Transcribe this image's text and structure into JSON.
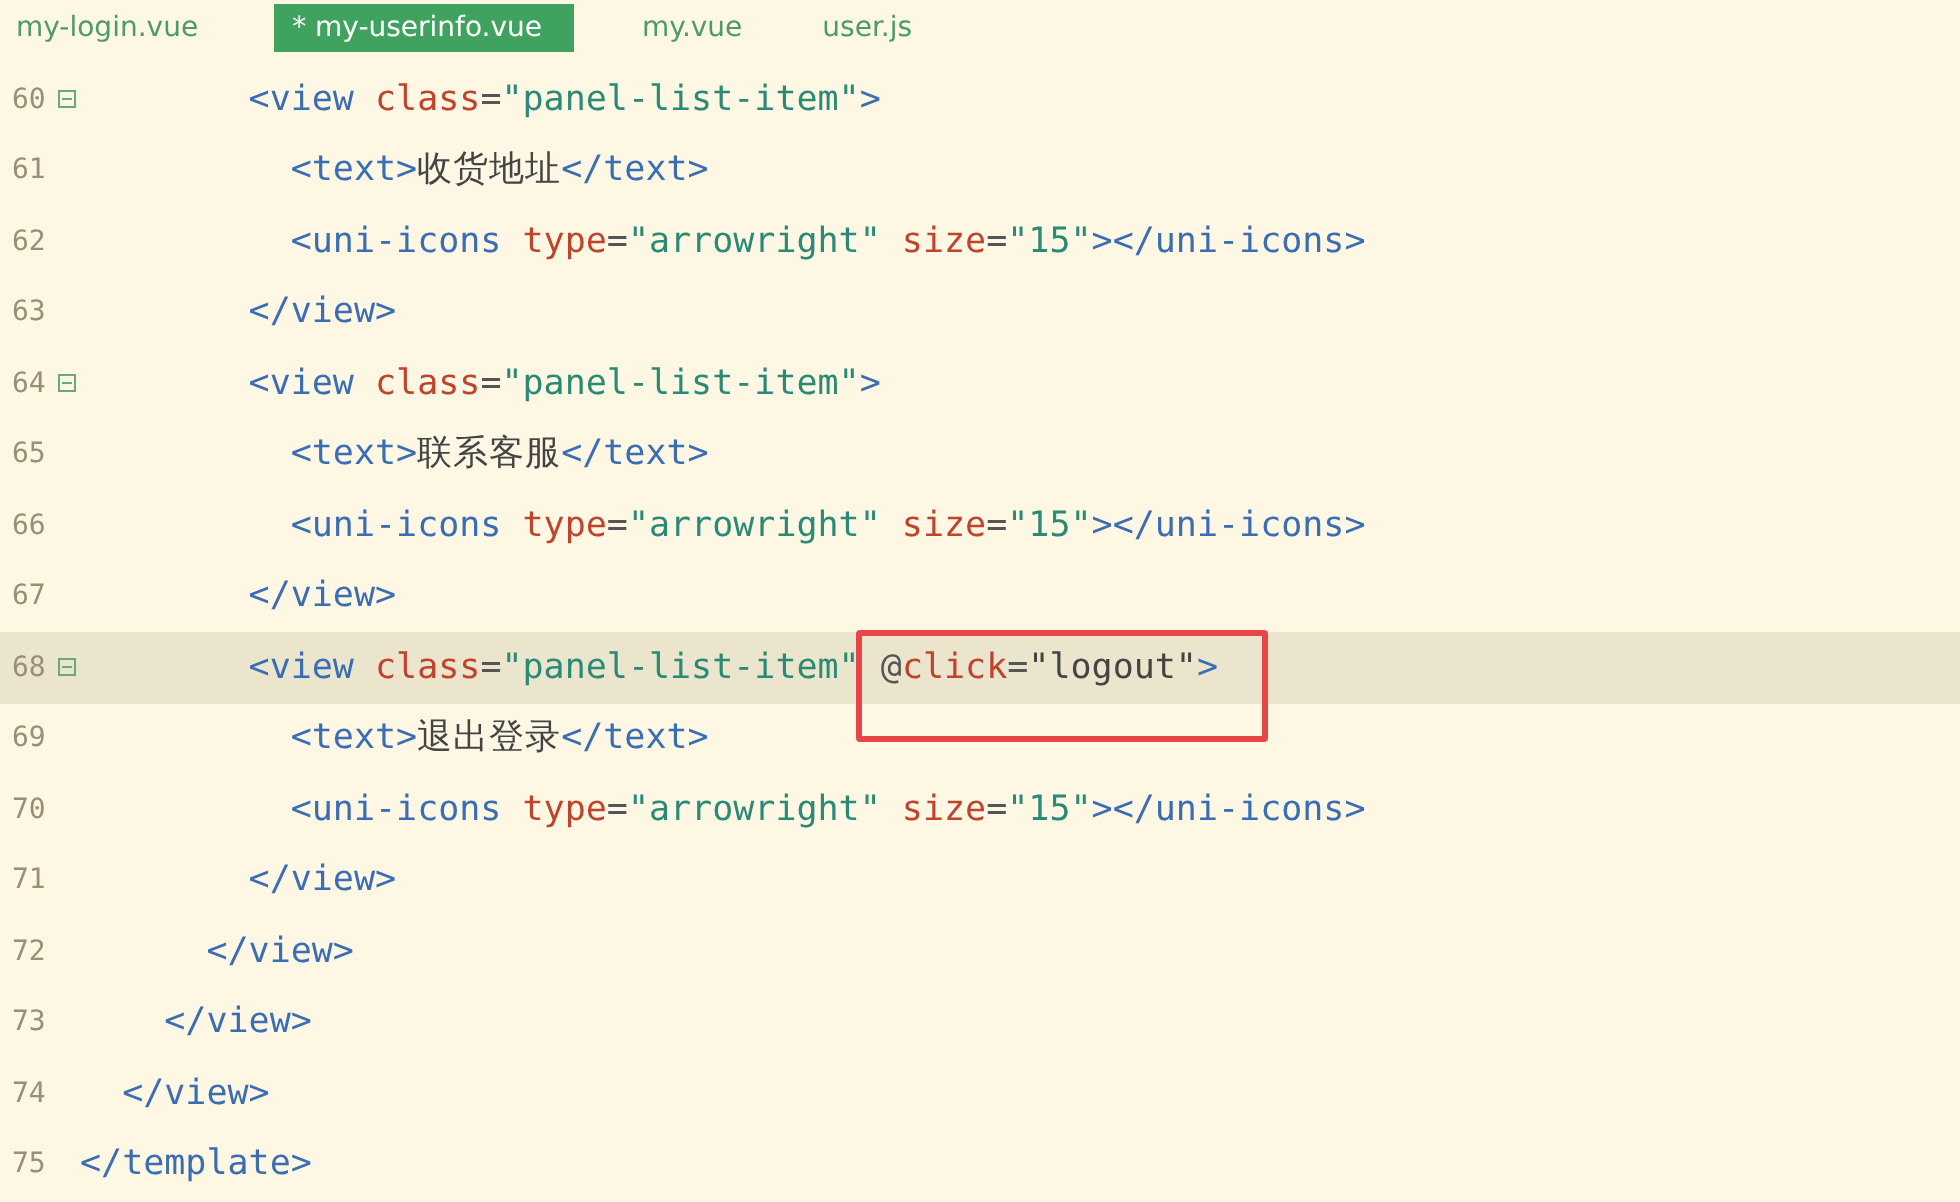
{
  "tabs": [
    {
      "label": "my-login.vue",
      "selected": false
    },
    {
      "label": "* my-userinfo.vue",
      "selected": true
    },
    {
      "label": "my.vue",
      "selected": false
    },
    {
      "label": "user.js",
      "selected": false
    }
  ],
  "lines": [
    {
      "number": "60",
      "foldable": true,
      "selected": false,
      "tokens": [
        {
          "kind": "tag",
          "text": "        <view"
        },
        {
          "kind": "attr",
          "text": " class"
        },
        {
          "kind": "op",
          "text": "="
        },
        {
          "kind": "string",
          "text": "\"panel-list-item\""
        },
        {
          "kind": "tag",
          "text": ">"
        }
      ]
    },
    {
      "number": "61",
      "foldable": false,
      "selected": false,
      "tokens": [
        {
          "kind": "tag",
          "text": "          <text>"
        },
        {
          "kind": "text",
          "text": "收货地址"
        },
        {
          "kind": "tag",
          "text": "</text>"
        }
      ]
    },
    {
      "number": "62",
      "foldable": false,
      "selected": false,
      "tokens": [
        {
          "kind": "tag",
          "text": "          <uni-icons"
        },
        {
          "kind": "attr",
          "text": " type"
        },
        {
          "kind": "op",
          "text": "="
        },
        {
          "kind": "string",
          "text": "\"arrowright\""
        },
        {
          "kind": "attr",
          "text": " size"
        },
        {
          "kind": "op",
          "text": "="
        },
        {
          "kind": "string",
          "text": "\"15\""
        },
        {
          "kind": "tag",
          "text": "></uni-icons>"
        }
      ]
    },
    {
      "number": "63",
      "foldable": false,
      "selected": false,
      "tokens": [
        {
          "kind": "tag",
          "text": "        </view>"
        }
      ]
    },
    {
      "number": "64",
      "foldable": true,
      "selected": false,
      "tokens": [
        {
          "kind": "tag",
          "text": "        <view"
        },
        {
          "kind": "attr",
          "text": " class"
        },
        {
          "kind": "op",
          "text": "="
        },
        {
          "kind": "string",
          "text": "\"panel-list-item\""
        },
        {
          "kind": "tag",
          "text": ">"
        }
      ]
    },
    {
      "number": "65",
      "foldable": false,
      "selected": false,
      "tokens": [
        {
          "kind": "tag",
          "text": "          <text>"
        },
        {
          "kind": "text",
          "text": "联系客服"
        },
        {
          "kind": "tag",
          "text": "</text>"
        }
      ]
    },
    {
      "number": "66",
      "foldable": false,
      "selected": false,
      "tokens": [
        {
          "kind": "tag",
          "text": "          <uni-icons"
        },
        {
          "kind": "attr",
          "text": " type"
        },
        {
          "kind": "op",
          "text": "="
        },
        {
          "kind": "string",
          "text": "\"arrowright\""
        },
        {
          "kind": "attr",
          "text": " size"
        },
        {
          "kind": "op",
          "text": "="
        },
        {
          "kind": "string",
          "text": "\"15\""
        },
        {
          "kind": "tag",
          "text": "></uni-icons>"
        }
      ]
    },
    {
      "number": "67",
      "foldable": false,
      "selected": false,
      "tokens": [
        {
          "kind": "tag",
          "text": "        </view>"
        }
      ]
    },
    {
      "number": "68",
      "foldable": true,
      "selected": true,
      "tokens": [
        {
          "kind": "tag",
          "text": "        <view"
        },
        {
          "kind": "attr",
          "text": " class"
        },
        {
          "kind": "op",
          "text": "="
        },
        {
          "kind": "string",
          "text": "\"panel-list-item\""
        },
        {
          "kind": "op",
          "text": " @",
          "annotated": true
        },
        {
          "kind": "attr",
          "text": "click",
          "annotated": true
        },
        {
          "kind": "op",
          "text": "=",
          "annotated": true
        },
        {
          "kind": "text",
          "text": "\"logout\"",
          "annotated": true
        },
        {
          "kind": "tag",
          "text": ">"
        }
      ]
    },
    {
      "number": "69",
      "foldable": false,
      "selected": false,
      "tokens": [
        {
          "kind": "tag",
          "text": "          <text>"
        },
        {
          "kind": "text",
          "text": "退出登录"
        },
        {
          "kind": "tag",
          "text": "</text>"
        }
      ]
    },
    {
      "number": "70",
      "foldable": false,
      "selected": false,
      "tokens": [
        {
          "kind": "tag",
          "text": "          <uni-icons"
        },
        {
          "kind": "attr",
          "text": " type"
        },
        {
          "kind": "op",
          "text": "="
        },
        {
          "kind": "string",
          "text": "\"arrowright\""
        },
        {
          "kind": "attr",
          "text": " size"
        },
        {
          "kind": "op",
          "text": "="
        },
        {
          "kind": "string",
          "text": "\"15\""
        },
        {
          "kind": "tag",
          "text": "></uni-icons>"
        }
      ]
    },
    {
      "number": "71",
      "foldable": false,
      "selected": false,
      "tokens": [
        {
          "kind": "tag",
          "text": "        </view>"
        }
      ]
    },
    {
      "number": "72",
      "foldable": false,
      "selected": false,
      "tokens": [
        {
          "kind": "tag",
          "text": "      </view>"
        }
      ]
    },
    {
      "number": "73",
      "foldable": false,
      "selected": false,
      "tokens": [
        {
          "kind": "tag",
          "text": "    </view>"
        }
      ]
    },
    {
      "number": "74",
      "foldable": false,
      "selected": false,
      "tokens": [
        {
          "kind": "tag",
          "text": "  </view>"
        }
      ]
    },
    {
      "number": "75",
      "foldable": false,
      "selected": false,
      "tokens": [
        {
          "kind": "tag",
          "text": "</template>"
        }
      ]
    }
  ]
}
